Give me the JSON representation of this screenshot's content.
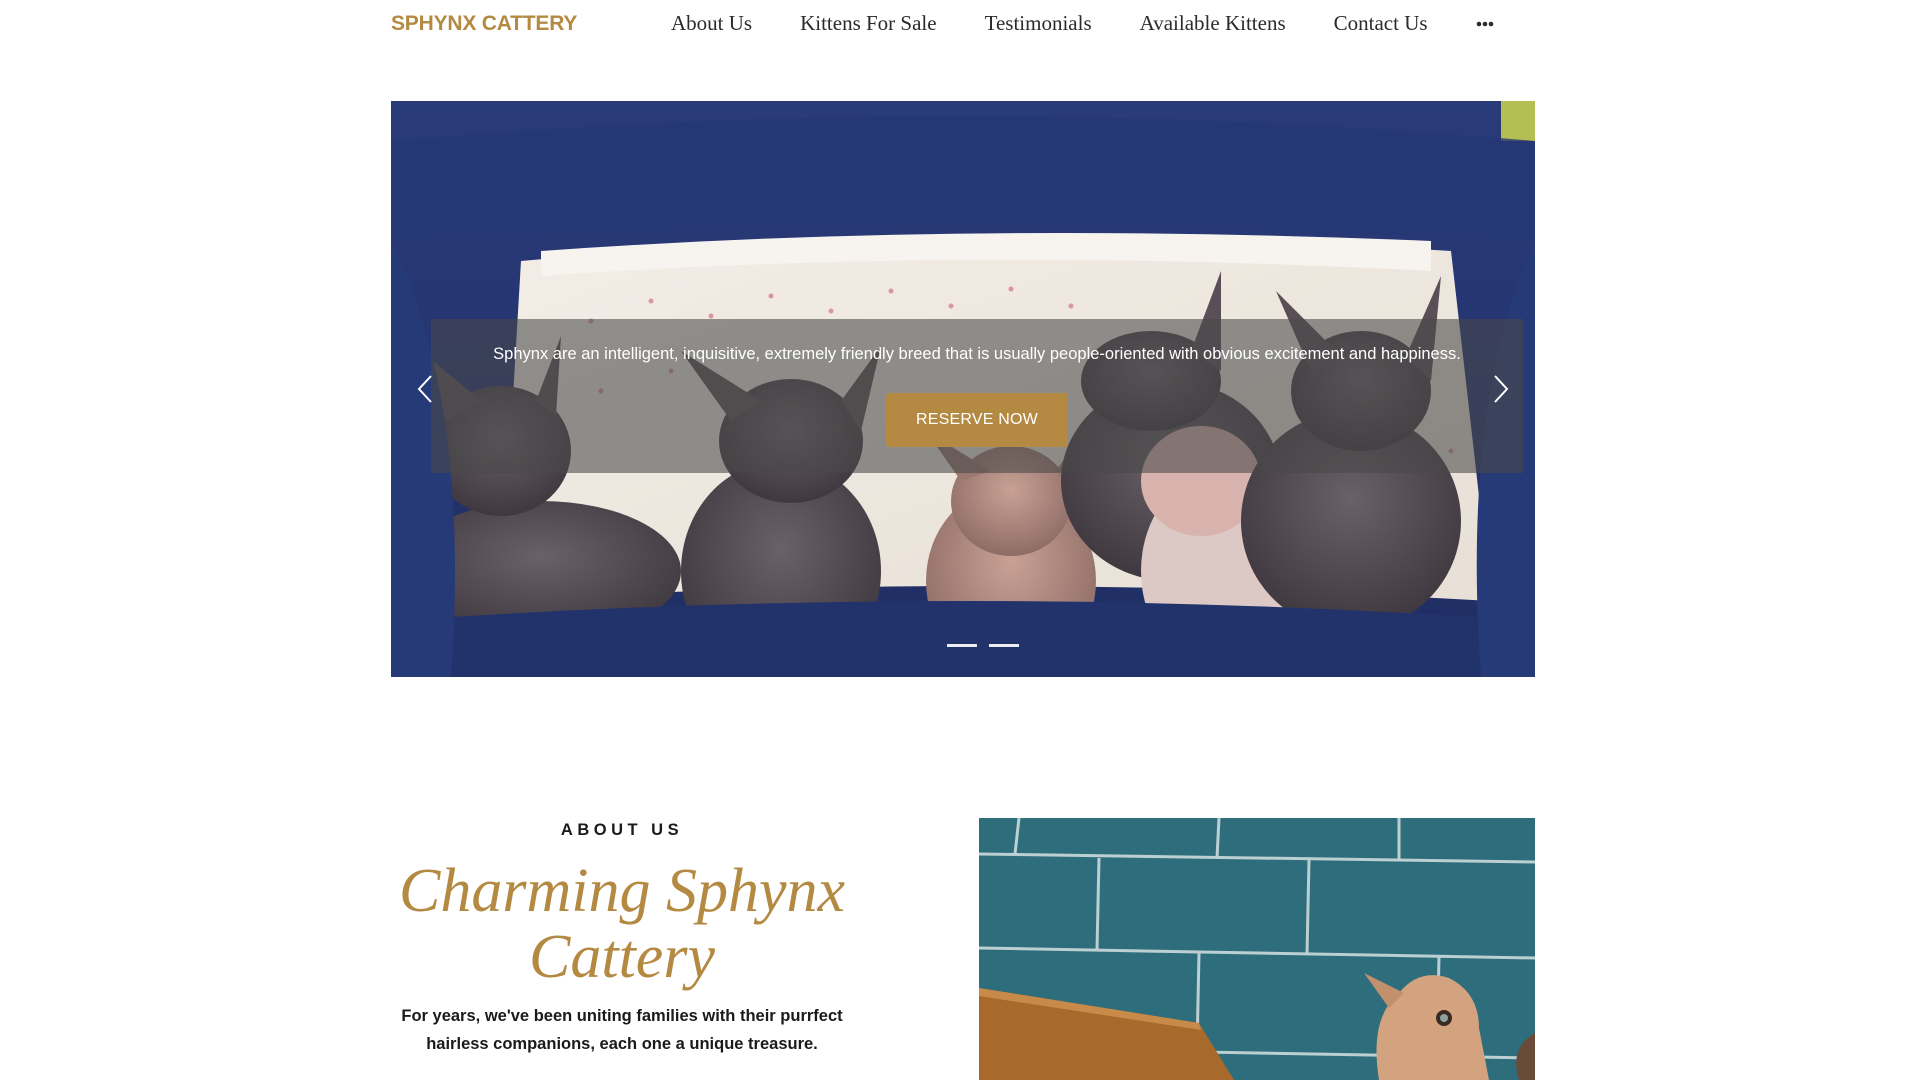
{
  "header": {
    "brand": "SPHYNX CATTERY",
    "nav": [
      {
        "label": "About Us"
      },
      {
        "label": "Kittens For Sale"
      },
      {
        "label": "Testimonials"
      },
      {
        "label": "Available Kittens"
      },
      {
        "label": "Contact Us"
      }
    ],
    "more_icon": "ellipsis-icon"
  },
  "hero": {
    "image": "photo of sphynx kittens in a blue pet bed",
    "caption": "Sphynx are an intelligent, inquisitive, extremely friendly breed that is usually people-oriented with obvious excitement and happiness.",
    "cta_label": "RESERVE NOW",
    "prev_icon": "chevron-left-icon",
    "next_icon": "chevron-right-icon",
    "slides": 2
  },
  "about": {
    "kicker": "ABOUT US",
    "title": "Charming Sphynx Cattery",
    "body": "For years, we've been uniting families with their purrfect hairless companions, each one a unique treasure.",
    "image": "photo of a sphynx cat near a teal tiled wall"
  },
  "colors": {
    "accent": "#b48a43",
    "text": "#1a1a1a",
    "background": "#ffffff",
    "overlay": "rgba(72,72,72,0.58)"
  }
}
